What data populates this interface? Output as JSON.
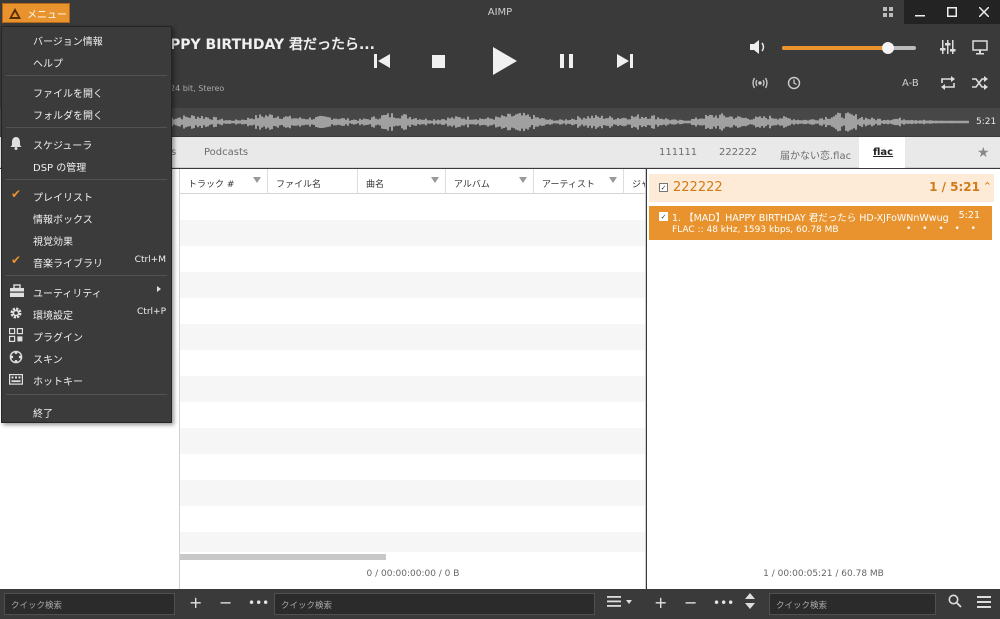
{
  "app": {
    "title": "AIMP",
    "menu_button_label": "メニュー"
  },
  "player": {
    "track_title": "PPY BIRTHDAY 君だったら...",
    "track_info": "24 bit, Stereo",
    "time_total": "5:21",
    "volume_percent": 79,
    "ab_label": "A-B"
  },
  "tabs": {
    "left_partial": "s",
    "podcasts": "Podcasts",
    "playlist_tabs": [
      "111111",
      "222222",
      "届かない恋.flac",
      "flac"
    ]
  },
  "columns": [
    "トラック #",
    "ファイル名",
    "曲名",
    "アルバム",
    "アーティスト",
    "ジャ"
  ],
  "middle_status": "0 / 00:00:00:00 / 0 B",
  "playlist": {
    "name": "222222",
    "count": "1 / 5:21",
    "item": {
      "title": "1. 【MAD】HAPPY BIRTHDAY  君だったら HD-XJFoWNnWwug",
      "duration": "5:21",
      "info": "FLAC :: 48 kHz, 1593 kbps, 60.78 MB",
      "dots": "• • • • •"
    },
    "status": "1 / 00:00:05:21 / 60.78 MB"
  },
  "bottom": {
    "search_placeholder": "クイック検索",
    "search2_placeholder": "クイック検索",
    "search3_placeholder": "クイック検索"
  },
  "menu": {
    "version_info": "バージョン情報",
    "help": "ヘルプ",
    "open_file": "ファイルを開く",
    "open_folder": "フォルダを開く",
    "scheduler": "スケジューラ",
    "dsp": "DSP の管理",
    "playlist": "プレイリスト",
    "info_box": "情報ボックス",
    "visual": "視覚効果",
    "music_library": "音楽ライブラリ",
    "music_library_shortcut": "Ctrl+M",
    "utilities": "ユーティリティ",
    "preferences": "環境設定",
    "preferences_shortcut": "Ctrl+P",
    "plugins": "プラグイン",
    "skins": "スキン",
    "hotkeys": "ホットキー",
    "exit": "終了"
  }
}
